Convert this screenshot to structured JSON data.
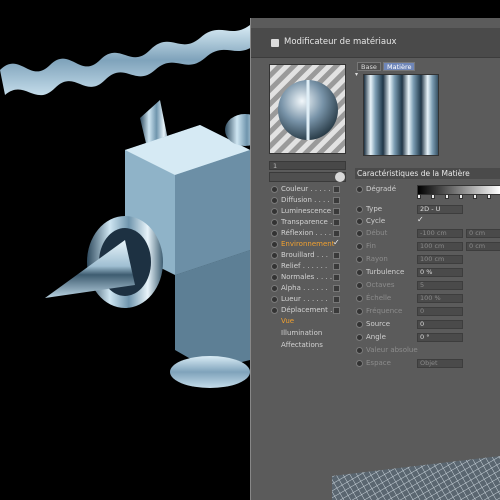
{
  "dialog": {
    "title": "Modificateur de matériaux",
    "name_field": "1",
    "tabs": [
      "Base",
      "Matière"
    ],
    "active_tab": "Matière",
    "accent_color": "#f0a030",
    "channels": [
      {
        "label": "Couleur",
        "dots": ". . . . .",
        "checked": false
      },
      {
        "label": "Diffusion",
        "dots": ". . . .",
        "checked": false
      },
      {
        "label": "Luminescence",
        "dots": "",
        "checked": false
      },
      {
        "label": "Transparence",
        "dots": ".",
        "checked": false
      },
      {
        "label": "Réflexion",
        "dots": ". . . .",
        "checked": false
      },
      {
        "label": "Environnement",
        "dots": "",
        "checked": true,
        "active": true
      },
      {
        "label": "Brouillard",
        "dots": ". . .",
        "checked": false
      },
      {
        "label": "Relief",
        "dots": ". . . . . .",
        "checked": false
      },
      {
        "label": "Normales",
        "dots": ". . . .",
        "checked": false
      },
      {
        "label": "Alpha",
        "dots": ". . . . . .",
        "checked": false
      },
      {
        "label": "Lueur",
        "dots": ". . . . . .",
        "checked": false
      },
      {
        "label": "Déplacement",
        "dots": ".",
        "checked": false
      }
    ],
    "sub_items": [
      "Vue",
      "Illumination",
      "Affectations"
    ],
    "section_title": "Caractéristiques de la Matière",
    "params": {
      "gradient_label": "Dégradé",
      "type_label": "Type",
      "type_value": "2D - U",
      "cycle_label": "Cycle",
      "debut_label": "Début",
      "debut_value": "-100 cm",
      "debut_value2": "0 cm",
      "fin_label": "Fin",
      "fin_value": "100 cm",
      "fin_value2": "0 cm",
      "rayon_label": "Rayon",
      "rayon_value": "100 cm",
      "turbulence_label": "Turbulence",
      "turbulence_value": "0 %",
      "octaves_label": "Octaves",
      "octaves_value": "5",
      "echelle_label": "Échelle",
      "echelle_value": "100 %",
      "frequence_label": "Fréquence",
      "frequence_value": "0",
      "source_label": "Source",
      "source_value": "0",
      "angle_label": "Angle",
      "angle_value": "0 °",
      "valeur_absolue_label": "Valeur absolue",
      "espace_label": "Espace",
      "espace_value": "Objet"
    }
  }
}
